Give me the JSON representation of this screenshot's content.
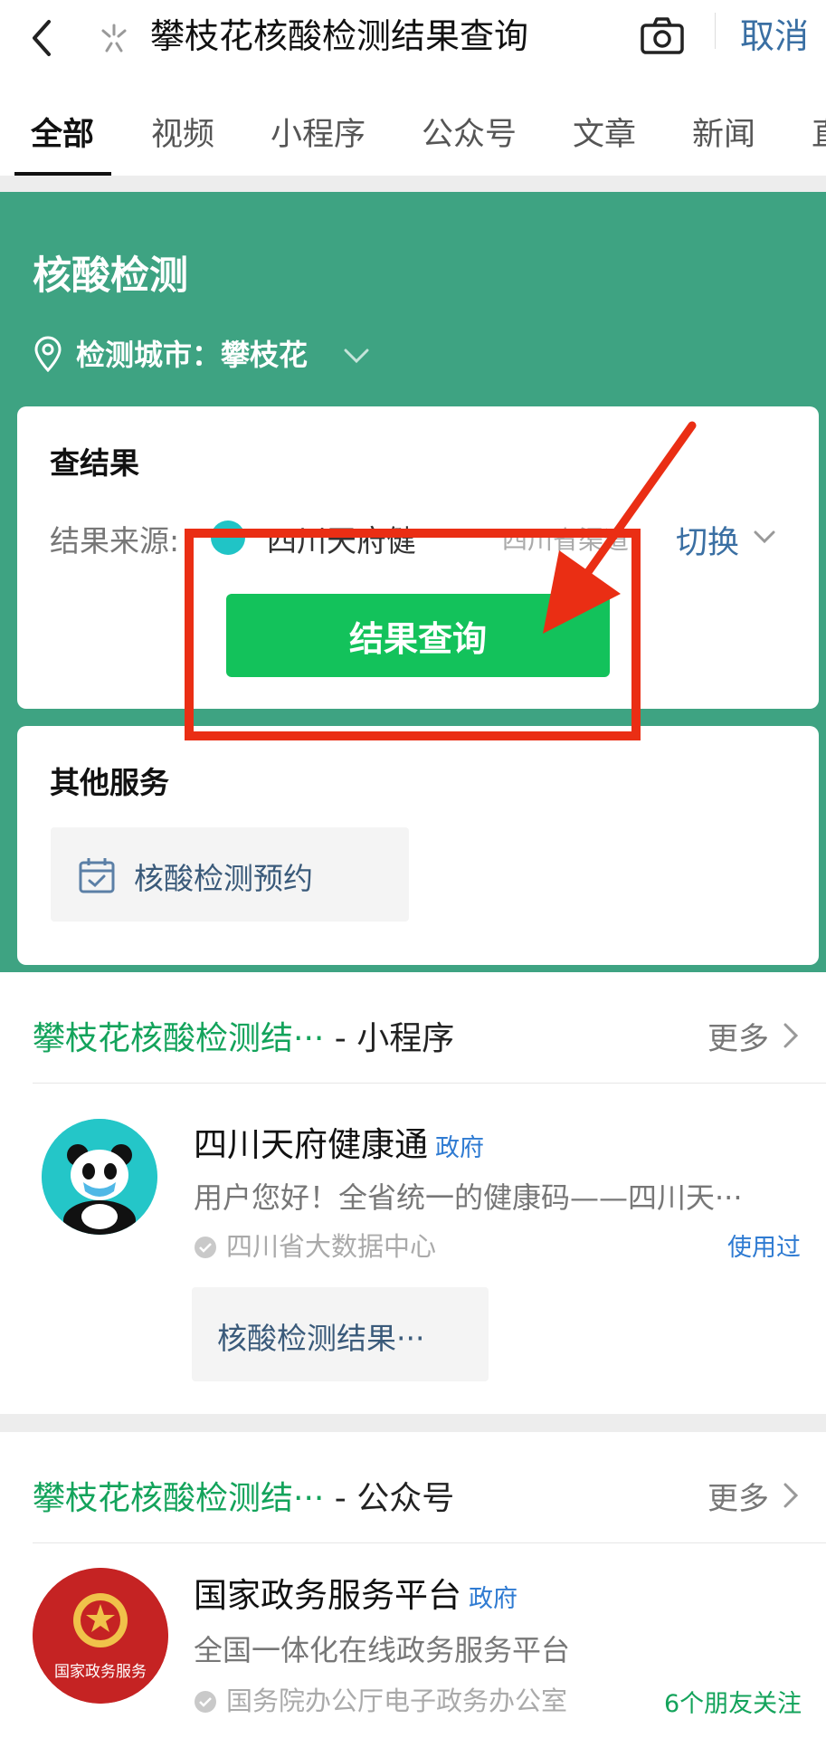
{
  "header": {
    "search_query": "攀枝花核酸检测结果查询",
    "cancel_label": "取消"
  },
  "tabs": [
    {
      "label": "全部",
      "active": true
    },
    {
      "label": "视频"
    },
    {
      "label": "小程序"
    },
    {
      "label": "公众号"
    },
    {
      "label": "文章"
    },
    {
      "label": "新闻"
    },
    {
      "label": "直"
    }
  ],
  "nucleic_card": {
    "title": "核酸检测",
    "city_label": "检测城市：攀枝花",
    "result_card": {
      "title": "查结果",
      "source_label": "结果来源:",
      "source_name": "四川天府健",
      "source_org": "四川省渠道",
      "switch_label": "切换",
      "query_button": "结果查询"
    },
    "other_services": {
      "title": "其他服务",
      "items": [
        {
          "label": "核酸检测预约",
          "icon": "calendar-check-icon"
        }
      ]
    }
  },
  "mini_program_section": {
    "head_green": "攀枝花核酸检测结···",
    "head_type": " - 小程序",
    "more_label": "更多",
    "item": {
      "name": "四川天府健康通",
      "badge": "政府",
      "desc": "用户您好！全省统一的健康码——四川天···",
      "verified_by": "四川省大数据中心",
      "status": "使用过",
      "sub_link": "核酸检测结果···"
    }
  },
  "official_account_section": {
    "head_green": "攀枝花核酸检测结···",
    "head_type": " - 公众号",
    "more_label": "更多",
    "item": {
      "name": "国家政务服务平台",
      "badge": "政府",
      "desc": "全国一体化在线政务服务平台",
      "verified_by": "国务院办公厅电子政务办公室",
      "friends": "6个朋友关注",
      "avatar_text": "国家政务服务"
    }
  },
  "colors": {
    "accent_green": "#13c25b",
    "card_bg_green": "#3ea382",
    "link_blue": "#3a6fa3",
    "annotation_red": "#ea2e14"
  }
}
